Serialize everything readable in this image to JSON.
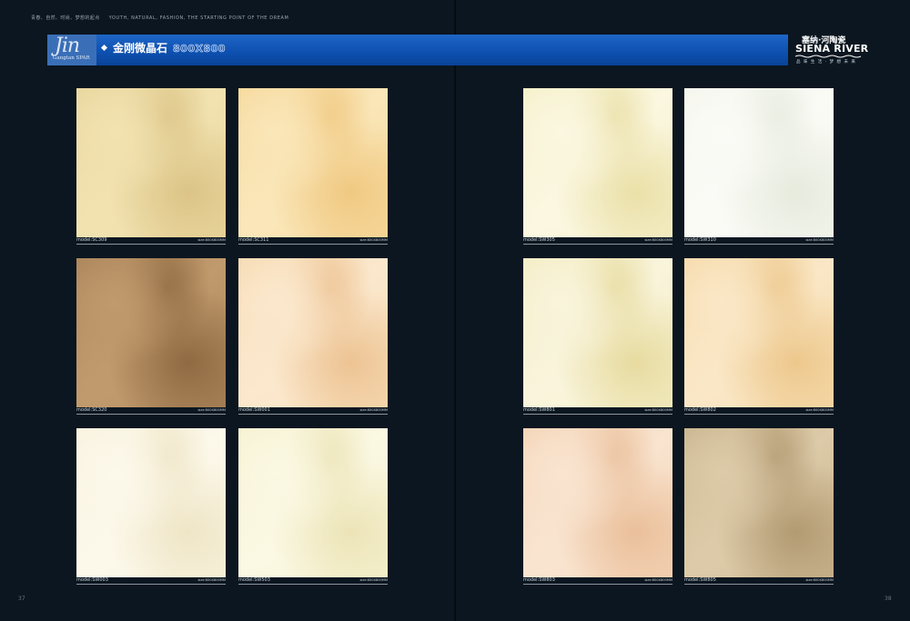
{
  "header": {
    "tagline_cn": "青春、自然、时尚、梦想的起点",
    "tagline_en": "YOUTH, NATURAL, FASHION, THE STARTING POINT OF THE DREAM",
    "logo_text": "Jin",
    "logo_subtext": "Gangtan SPAR",
    "title": "金刚微晶石",
    "title_size": "800X800",
    "brand_cn": "塞纳·河陶瓷",
    "brand_en": "SIENA RIVER",
    "brand_slogan": "品 味 生 活 · 梦 想 未 来",
    "banner_color": "#1559bf"
  },
  "tiles": [
    {
      "model": "model:SC309",
      "size": "size:800X800MM",
      "colors": [
        "#e9d59c",
        "#dcc486",
        "#f1e2b0"
      ]
    },
    {
      "model": "model:SC311",
      "size": "size:800X800MM",
      "colors": [
        "#f6d89a",
        "#f0c982",
        "#fae6b8"
      ]
    },
    {
      "model": "model:SC320",
      "size": "size:800X800MM",
      "colors": [
        "#a9835a",
        "#8f6a42",
        "#c09a6c"
      ]
    },
    {
      "model": "model:SW001",
      "size": "size:800X800MM",
      "colors": [
        "#f6d9b0",
        "#edc393",
        "#fbe8cd"
      ]
    },
    {
      "model": "model:SW003",
      "size": "size:800X800MM",
      "colors": [
        "#f8f2dc",
        "#efe5c6",
        "#fcf8ea"
      ]
    },
    {
      "model": "model:SW503",
      "size": "size:800X800MM",
      "colors": [
        "#f6f1cf",
        "#ece4b7",
        "#fbf8e3"
      ]
    },
    {
      "model": "model:SW305",
      "size": "size:800X800MM",
      "colors": [
        "#f5efc7",
        "#eae0a8",
        "#fbf7e0"
      ]
    },
    {
      "model": "model:SW310",
      "size": "size:800X800MM",
      "colors": [
        "#f4f5ec",
        "#e6ebde",
        "#fbfbf6"
      ]
    },
    {
      "model": "model:SW801",
      "size": "size:800X800MM",
      "colors": [
        "#f3ecc2",
        "#e7dba0",
        "#f9f4db"
      ]
    },
    {
      "model": "model:SW802",
      "size": "size:800X800MM",
      "colors": [
        "#f6d9a8",
        "#edc88d",
        "#fae7c6"
      ]
    },
    {
      "model": "model:SW803",
      "size": "size:800X800MM",
      "colors": [
        "#f4d3b4",
        "#eabf9a",
        "#f9e4d0"
      ]
    },
    {
      "model": "model:SW805",
      "size": "size:800X800MM",
      "colors": [
        "#c9b48e",
        "#b29a72",
        "#dccaa8"
      ]
    }
  ],
  "page_numbers": {
    "left": "37",
    "right": "38"
  }
}
